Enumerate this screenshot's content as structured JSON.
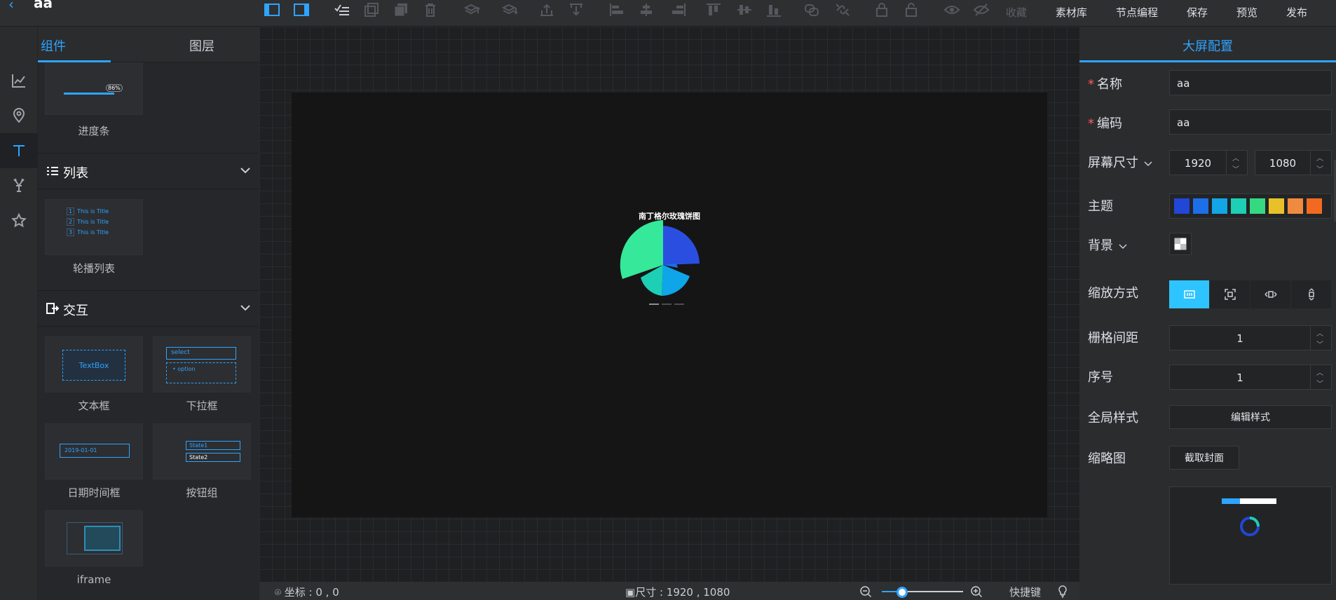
{
  "app": {
    "title": "aa",
    "back_icon": "arrow-left-icon"
  },
  "toolbar": {
    "icons": [
      "panel-left-icon",
      "panel-right-icon",
      "check-list-icon",
      "copy-icon",
      "duplicate-icon",
      "delete-icon",
      "layer-up-icon",
      "layer-down-icon",
      "move-top-icon",
      "move-bottom-icon",
      "align-left-icon",
      "align-center-h-icon",
      "align-right-icon",
      "align-top-icon",
      "align-center-v-icon",
      "align-bottom-icon",
      "group-icon",
      "ungroup-icon",
      "lock-icon",
      "unlock-icon",
      "show-icon",
      "hide-icon"
    ],
    "collect_label": "收藏",
    "assets_label": "素材库",
    "node_edit_label": "节点编程",
    "save_label": "保存",
    "preview_label": "预览",
    "publish_label": "发布"
  },
  "rail": {
    "icons": [
      "chart-icon",
      "map-pin-icon",
      "text-icon",
      "deer-icon",
      "star-icon"
    ],
    "active_index": 2
  },
  "panel": {
    "tabs": [
      "组件",
      "图层"
    ],
    "active_tab": 0,
    "progress_card": {
      "label": "进度条",
      "preview_text": "86%"
    },
    "list_section": {
      "title": "列表",
      "items": [
        {
          "label": "轮播列表",
          "preview_rows": [
            {
              "index": "1",
              "text": "This  is  Title"
            },
            {
              "index": "2",
              "text": "This  is  Title"
            },
            {
              "index": "3",
              "text": "This  is  Title"
            }
          ]
        }
      ]
    },
    "interaction_section": {
      "title": "交互",
      "items": [
        {
          "label": "文本框",
          "preview_text": "TextBox"
        },
        {
          "label": "下拉框",
          "preview_text": "select",
          "preview_option": "option"
        },
        {
          "label": "日期时间框",
          "preview_text": "2019-01-01"
        },
        {
          "label": "按钮组",
          "preview_states": [
            "State1",
            "State2"
          ]
        },
        {
          "label": "iframe"
        }
      ]
    }
  },
  "canvas": {
    "chart_title": "南丁格尔玫瑰饼图",
    "chart_colors": [
      "#2a4fe0",
      "#0ea5e9",
      "#1ccfb5",
      "#35e89a"
    ]
  },
  "status": {
    "coord_label": "坐标 : 0 , 0",
    "size_label": "尺寸 : 1920 , 1080",
    "zoom_fraction": 0.25,
    "shortcut_label": "快捷键"
  },
  "config": {
    "title": "大屏配置",
    "name_label": "名称",
    "name_value": "aa",
    "code_label": "编码",
    "code_value": "aa",
    "screen_size_label": "屏幕尺寸",
    "width_value": "1920",
    "height_value": "1080",
    "theme_label": "主题",
    "theme_colors": [
      "#2246d6",
      "#1c6fe8",
      "#12a6e6",
      "#1ccfb5",
      "#35d982",
      "#e8c12a",
      "#f08a3e",
      "#f26a21"
    ],
    "background_label": "背景",
    "scale_label": "缩放方式",
    "scale_icons": [
      "fit-full-icon",
      "fit-contain-icon",
      "fit-width-icon",
      "fit-height-icon"
    ],
    "scale_active": 0,
    "grid_label": "栅格间距",
    "grid_value": "1",
    "order_label": "序号",
    "order_value": "1",
    "global_style_label": "全局样式",
    "edit_style_btn": "编辑样式",
    "thumbnail_label": "缩略图",
    "capture_btn": "截取封面"
  }
}
